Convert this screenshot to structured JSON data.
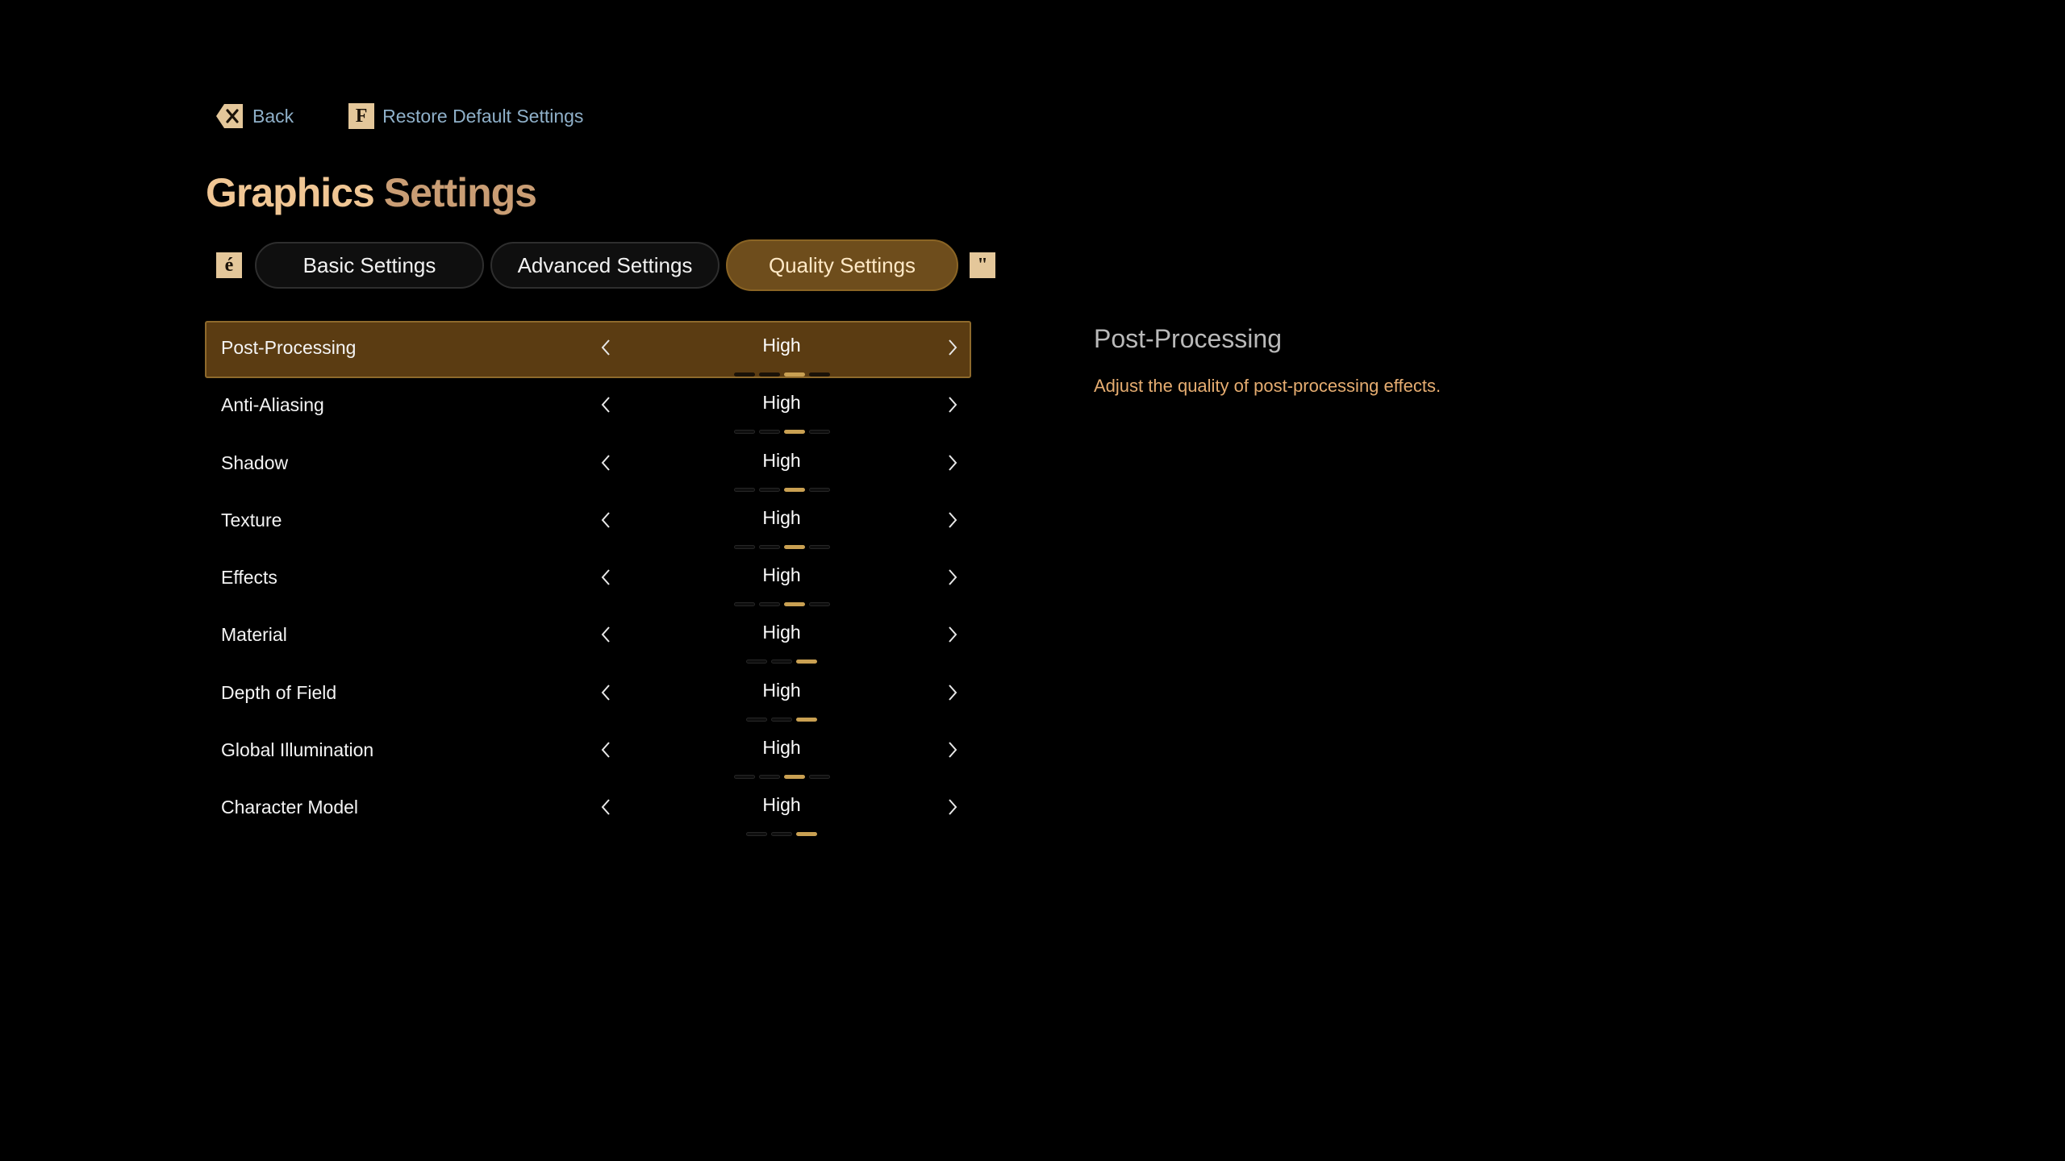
{
  "actions": {
    "back_label": "Back",
    "restore_key": "F",
    "restore_label": "Restore Default Settings"
  },
  "title": {
    "primary": "Graphics",
    "secondary": "Settings"
  },
  "tabs": {
    "left_bumper": "é",
    "right_bumper": "\"",
    "items": [
      {
        "label": "Basic Settings",
        "active": false
      },
      {
        "label": "Advanced Settings",
        "active": false
      },
      {
        "label": "Quality Settings",
        "active": true
      }
    ]
  },
  "settings": [
    {
      "name": "Post-Processing",
      "value": "High",
      "levels": 4,
      "current": 3,
      "selected": true
    },
    {
      "name": "Anti-Aliasing",
      "value": "High",
      "levels": 4,
      "current": 3,
      "selected": false
    },
    {
      "name": "Shadow",
      "value": "High",
      "levels": 4,
      "current": 3,
      "selected": false
    },
    {
      "name": "Texture",
      "value": "High",
      "levels": 4,
      "current": 3,
      "selected": false
    },
    {
      "name": "Effects",
      "value": "High",
      "levels": 4,
      "current": 3,
      "selected": false
    },
    {
      "name": "Material",
      "value": "High",
      "levels": 3,
      "current": 3,
      "selected": false
    },
    {
      "name": "Depth of Field",
      "value": "High",
      "levels": 3,
      "current": 3,
      "selected": false
    },
    {
      "name": "Global Illumination",
      "value": "High",
      "levels": 4,
      "current": 3,
      "selected": false
    },
    {
      "name": "Character Model",
      "value": "High",
      "levels": 3,
      "current": 3,
      "selected": false
    }
  ],
  "description": {
    "title": "Post-Processing",
    "text": "Adjust the quality of post-processing effects."
  },
  "colors": {
    "background": "#000000",
    "accent_gold": "#c9a052",
    "selected_row": "#5b3c12",
    "active_tab": "#6e4d1c",
    "title_primary": "#f0c694",
    "link_blue": "#8fb0c9",
    "description_text": "#e6ad71"
  },
  "icons": {
    "back": "backspace-x-icon",
    "prev": "chevron-left-icon",
    "next": "chevron-right-icon"
  }
}
